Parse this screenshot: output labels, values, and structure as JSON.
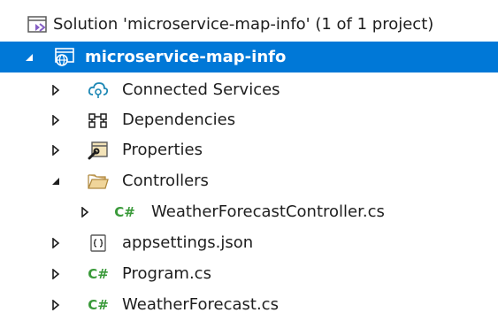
{
  "solution_explorer": {
    "solution": {
      "label": "Solution 'microservice-map-info' (1 of 1 project)"
    },
    "project": {
      "label": "microservice-map-info"
    },
    "items": [
      {
        "label": "Connected Services",
        "icon": "connected-services-icon"
      },
      {
        "label": "Dependencies",
        "icon": "dependencies-icon"
      },
      {
        "label": "Properties",
        "icon": "properties-icon"
      },
      {
        "label": "Controllers",
        "icon": "folder-open-icon"
      },
      {
        "label": "WeatherForecastController.cs",
        "icon": "csharp-file-icon"
      },
      {
        "label": "appsettings.json",
        "icon": "json-file-icon"
      },
      {
        "label": "Program.cs",
        "icon": "csharp-file-icon"
      },
      {
        "label": "WeatherForecast.cs",
        "icon": "csharp-file-icon"
      }
    ],
    "colors": {
      "selection": "#0078d7",
      "csharp": "#3a9a3a",
      "folder": "#dcb67a",
      "cloud": "#1e88b5"
    },
    "csharp_glyph": "C#"
  }
}
